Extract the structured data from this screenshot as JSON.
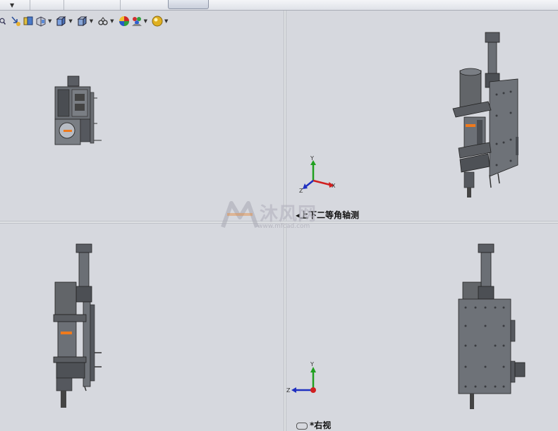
{
  "toolbar": {
    "icons": [
      "zoom-icon",
      "zoom-to-area-icon",
      "previous-view-icon",
      "section-view-icon",
      "view-orientation-icon",
      "display-style-icon",
      "hide-show-icon",
      "edit-appearance-icon",
      "apply-scene-icon",
      "view-settings-icon"
    ]
  },
  "views": {
    "top_right": {
      "label": "◂上下二等角轴测"
    },
    "bottom_right": {
      "label": "*右视"
    }
  },
  "triad": {
    "iso": {
      "x": "X",
      "y": "Y",
      "z": "Z"
    },
    "right": {
      "y": "Y",
      "z": "Z"
    }
  },
  "watermark": {
    "text": "沐风网",
    "url": "www.mfcad.com"
  },
  "colors": {
    "background": "#d6d8de",
    "model": "#4e5156",
    "accent": "#f07a1c",
    "x_axis": "#d02020",
    "y_axis": "#20a020",
    "z_axis": "#2030c0"
  }
}
